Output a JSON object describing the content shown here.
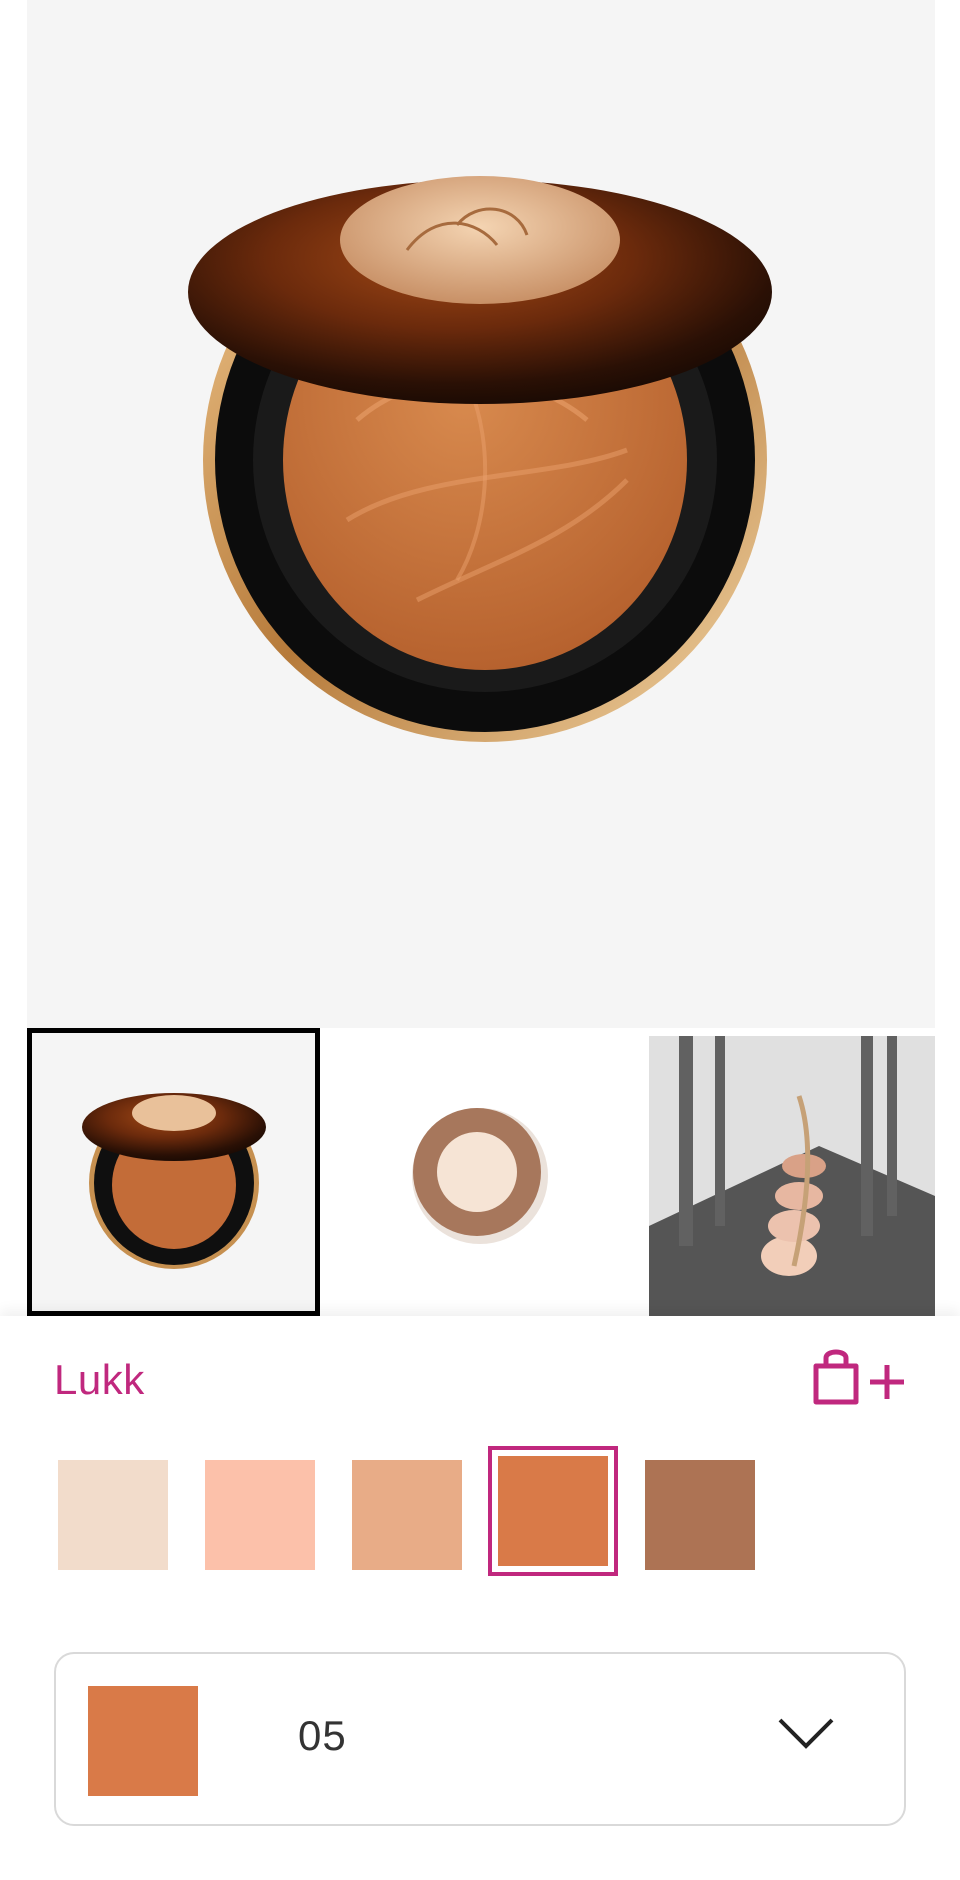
{
  "colors": {
    "accent": "#c0287e",
    "selected_shade": "#d97a48"
  },
  "icons": {
    "add_to_bag": "shopping-bag-plus-icon",
    "dropdown": "chevron-down-icon"
  },
  "shades": {
    "title": "Lukk",
    "swatches": [
      {
        "color": "#f2dccb"
      },
      {
        "color": "#fcc1aa"
      },
      {
        "color": "#e8ac87"
      },
      {
        "color": "#d97a48",
        "selected": true
      },
      {
        "color": "#ad7354"
      }
    ]
  },
  "shade_select": {
    "value": "05",
    "color": "#d97a48"
  }
}
